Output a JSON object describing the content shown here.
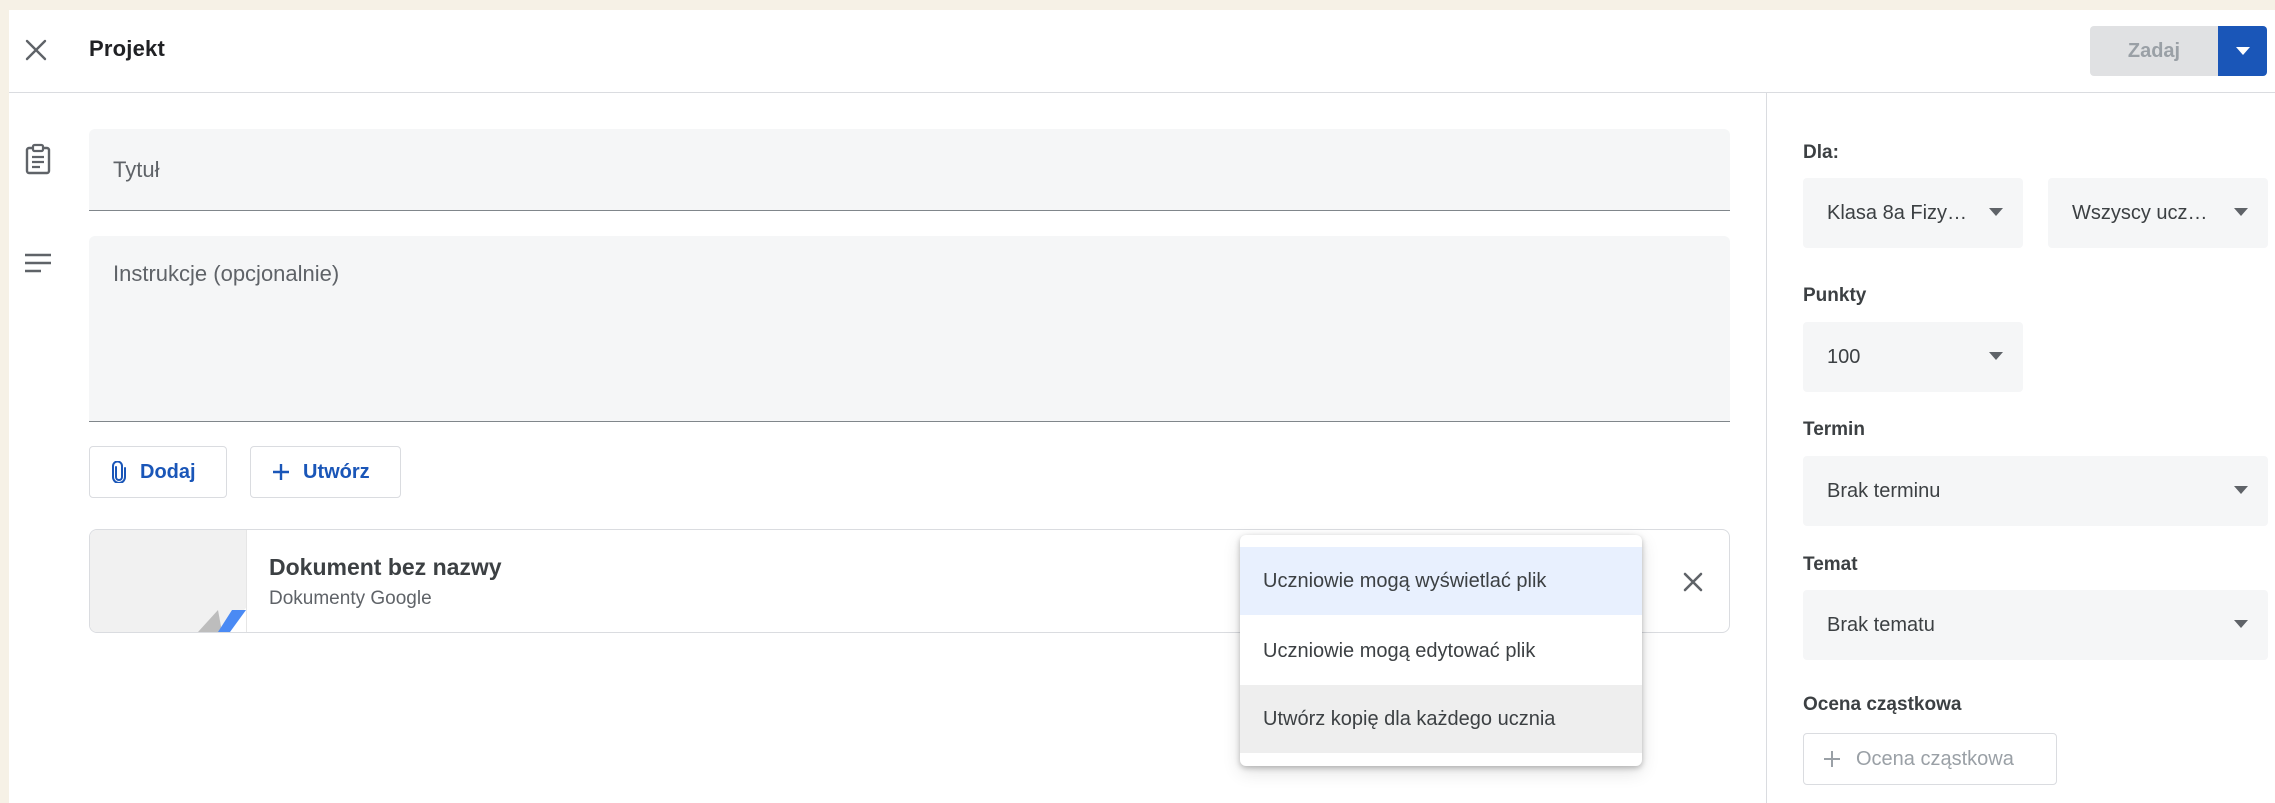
{
  "header": {
    "title": "Projekt",
    "assign_label": "Zadaj",
    "accent": "#1a56b8"
  },
  "form": {
    "title_placeholder": "Tytuł",
    "instructions_placeholder": "Instrukcje (opcjonalnie)",
    "add_label": "Dodaj",
    "create_label": "Utwórz"
  },
  "attachment": {
    "name": "Dokument bez nazwy",
    "type": "Dokumenty Google"
  },
  "share_menu": {
    "items": [
      {
        "label": "Uczniowie mogą wyświetlać plik",
        "state": "selected"
      },
      {
        "label": "Uczniowie mogą edytować plik",
        "state": "normal"
      },
      {
        "label": "Utwórz kopię dla każdego ucznia",
        "state": "hover"
      }
    ]
  },
  "sidebar": {
    "for_label": "Dla:",
    "class_value": "Klasa 8a Fizy…",
    "students_value": "Wszyscy ucz…",
    "points_label": "Punkty",
    "points_value": "100",
    "due_label": "Termin",
    "due_value": "Brak terminu",
    "topic_label": "Temat",
    "topic_value": "Brak tematu",
    "grading_label": "Ocena cząstkowa",
    "grading_button": "Ocena cząstkowa"
  },
  "icons": [
    "close-icon",
    "assignment-icon",
    "notes-icon",
    "paperclip-icon",
    "plus-icon",
    "dropdown-arrow-icon"
  ]
}
